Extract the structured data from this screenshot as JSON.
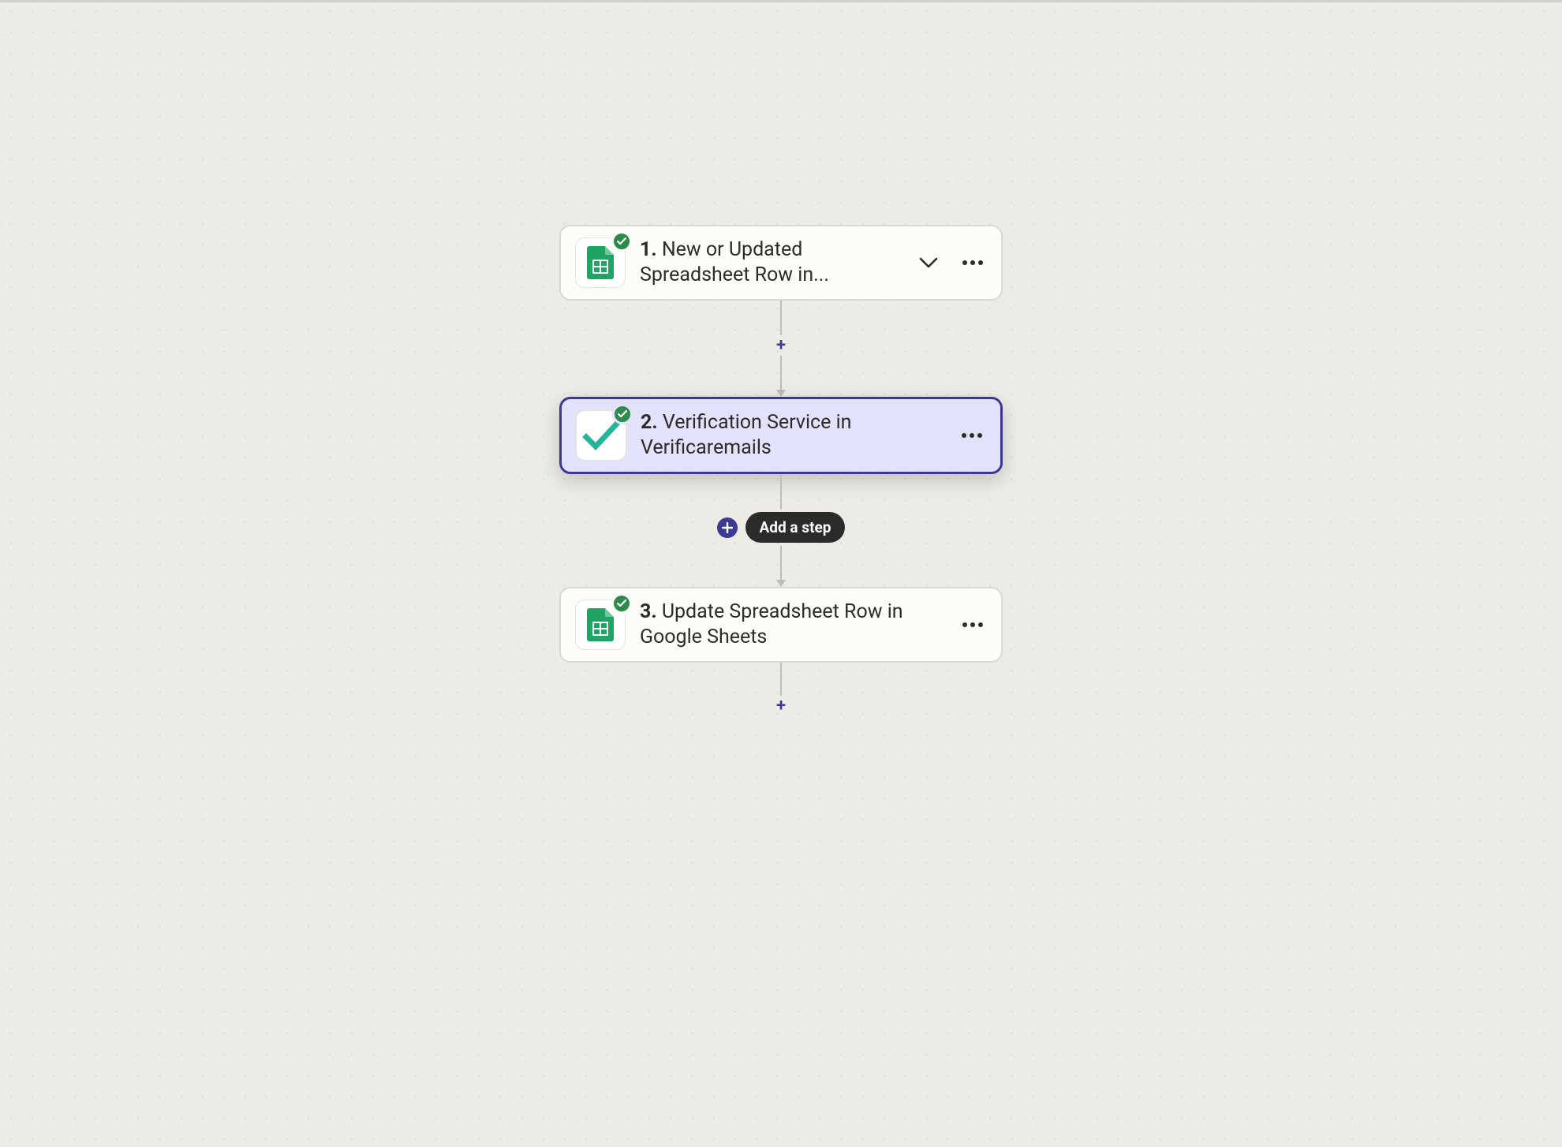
{
  "flow": {
    "steps": [
      {
        "num": "1.",
        "title": "New or Updated Spreadsheet Row in...",
        "icon": "google-sheets",
        "status": "ok",
        "expandable": true,
        "selected": false
      },
      {
        "num": "2.",
        "title": "Verification Service in Verificaremails",
        "icon": "verificaremails",
        "status": "ok",
        "expandable": false,
        "selected": true
      },
      {
        "num": "3.",
        "title": "Update Spreadsheet Row in Google Sheets",
        "icon": "google-sheets",
        "status": "ok",
        "expandable": false,
        "selected": false
      }
    ],
    "add_step_label": "Add a step"
  }
}
